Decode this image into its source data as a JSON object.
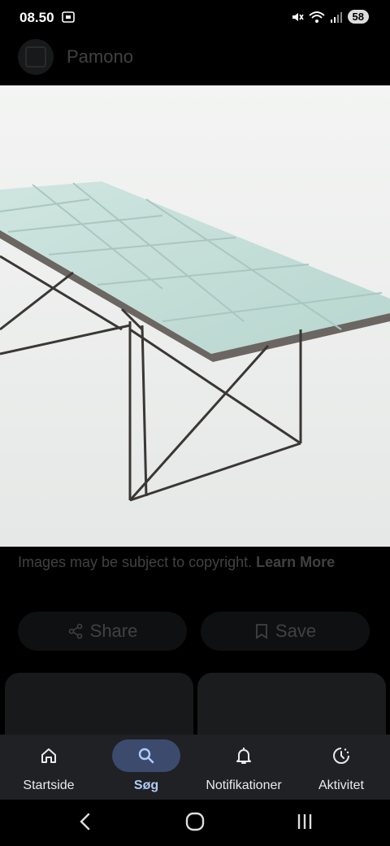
{
  "status_bar": {
    "time": "08.50",
    "battery": "58"
  },
  "source": {
    "name": "Pamono"
  },
  "caption": {
    "text": "Images may be subject to copyright. ",
    "link": "Learn More"
  },
  "actions": {
    "share_label": "Share",
    "save_label": "Save"
  },
  "bottom_nav": {
    "items": [
      {
        "label": "Startside",
        "icon": "home-icon"
      },
      {
        "label": "Søg",
        "icon": "search-icon",
        "active": true
      },
      {
        "label": "Notifikationer",
        "icon": "bell-icon"
      },
      {
        "label": "Aktivitet",
        "icon": "activity-icon"
      }
    ]
  },
  "system_nav": {
    "buttons": [
      "back-icon",
      "home-circle-icon",
      "recents-icon"
    ]
  }
}
